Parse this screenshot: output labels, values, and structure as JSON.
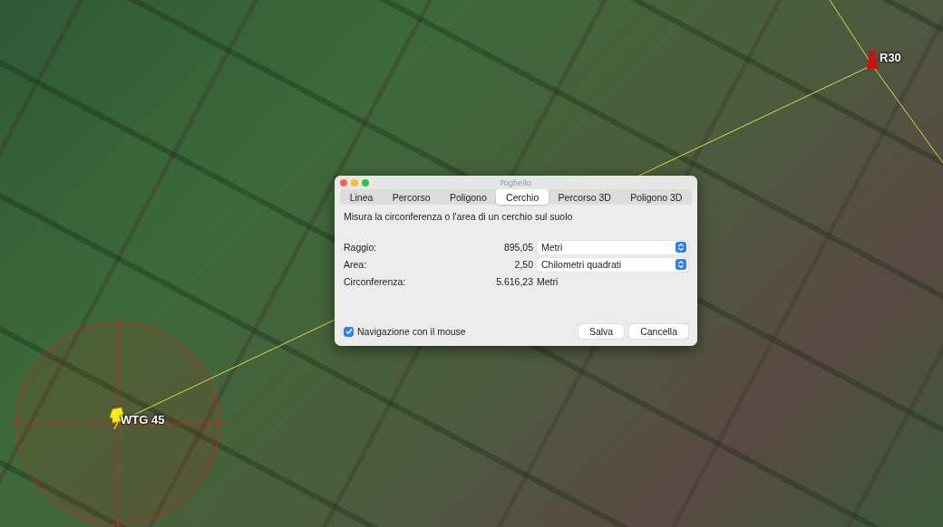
{
  "dialog": {
    "title": "Righello",
    "tabs": [
      {
        "label": "Linea",
        "selected": false
      },
      {
        "label": "Percorso",
        "selected": false
      },
      {
        "label": "Poligono",
        "selected": false
      },
      {
        "label": "Cerchio",
        "selected": true
      },
      {
        "label": "Percorso 3D",
        "selected": false
      },
      {
        "label": "Poligono 3D",
        "selected": false
      }
    ],
    "description": "Misura la circonferenza o l'area di un cerchio sul suolo",
    "fields": [
      {
        "label": "Raggio:",
        "value": "895,05",
        "kind": "select",
        "unit": "Metri"
      },
      {
        "label": "Area:",
        "value": "2,50",
        "kind": "select",
        "unit": "Chilometri quadrati"
      },
      {
        "label": "Circonferenza:",
        "value": "5.616,23",
        "kind": "text",
        "unit": "Metri"
      }
    ],
    "mouse_navigation": {
      "label": "Navigazione con il mouse",
      "checked": true
    },
    "buttons": [
      "Salva",
      "Cancella"
    ]
  },
  "placemarks": [
    {
      "label": "WTG 45",
      "kind": "pushpin"
    },
    {
      "label": "R30",
      "kind": "tower"
    }
  ]
}
